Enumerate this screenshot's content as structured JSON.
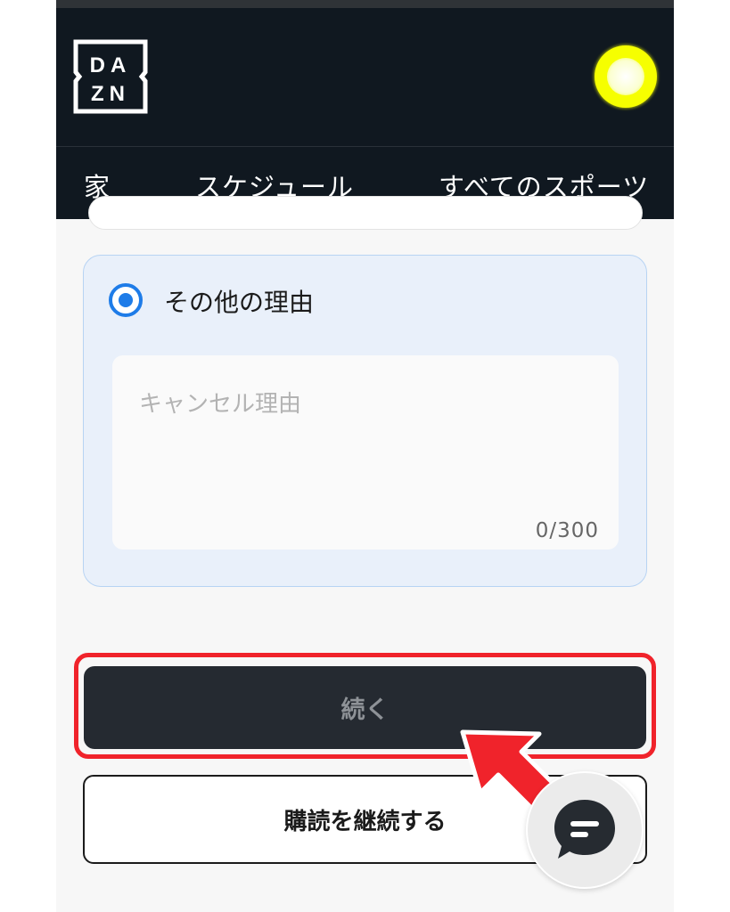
{
  "brand": {
    "logo_text_top": "DA",
    "logo_text_bottom": "ZN"
  },
  "nav": {
    "items": [
      {
        "label": "家"
      },
      {
        "label": "スケジュール"
      },
      {
        "label": "すべてのスポーツ"
      }
    ]
  },
  "reason": {
    "option_label": "その他の理由",
    "selected": true,
    "textarea_placeholder": "キャンセル理由",
    "textarea_value": "",
    "char_counter": "0/300"
  },
  "actions": {
    "continue_label": "続く",
    "keep_subscription_label": "購読を継続する"
  },
  "colors": {
    "header_bg": "#101820",
    "accent_blue": "#1e7ce8",
    "highlight_red": "#f0232b",
    "avatar_yellow": "#f6ff00"
  },
  "icons": {
    "avatar": "user-avatar-icon",
    "chat": "chat-bubble-icon",
    "pointer": "red-arrow-pointer-icon"
  }
}
